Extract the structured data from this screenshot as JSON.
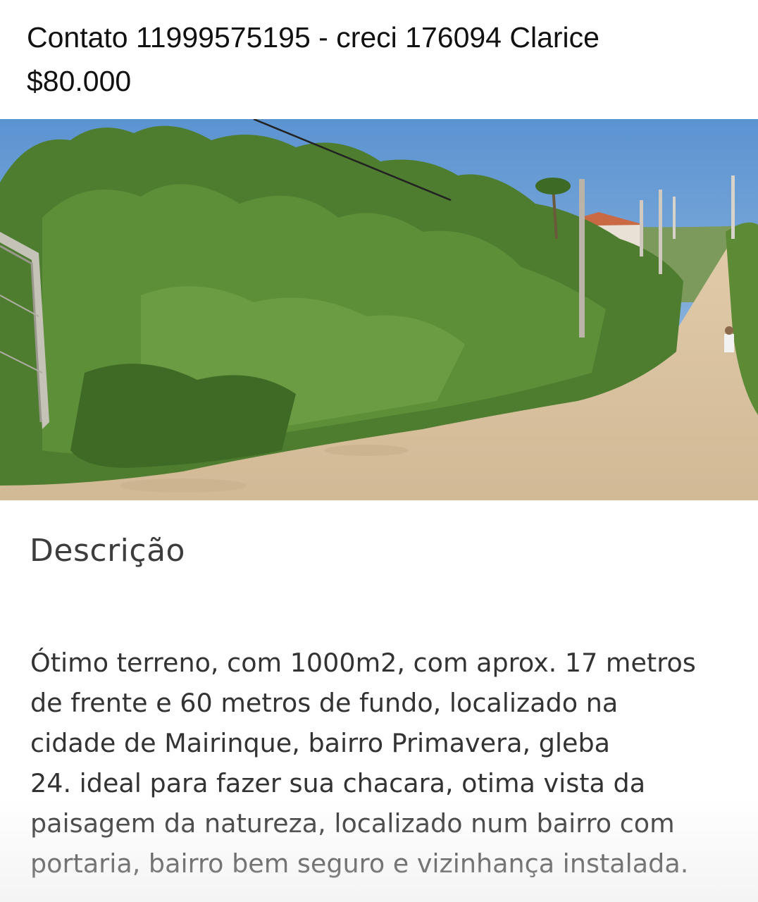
{
  "header": {
    "contact_line": "Contato 11999575195 - creci 176094 Clarice",
    "price": "$80.000"
  },
  "photo": {
    "icon": "listing-photo-land-with-vegetation-and-dirt-road"
  },
  "description": {
    "title": "Descrição",
    "lines": [
      "Ótimo terreno, com 1000m2, com aprox. 17 metros",
      "de frente e 60 metros de fundo, localizado na",
      "cidade de Mairinque, bairro Primavera, gleba",
      "24. ideal para fazer sua chacara, otima vista da",
      "paisagem da natureza, localizado num bairro com",
      "portaria, bairro bem seguro e vizinhança instalada."
    ]
  },
  "colors": {
    "sky": "#6ea3d6",
    "vegetation": "#4d7a2e",
    "road": "#d9c3a2",
    "text": "#333333"
  }
}
